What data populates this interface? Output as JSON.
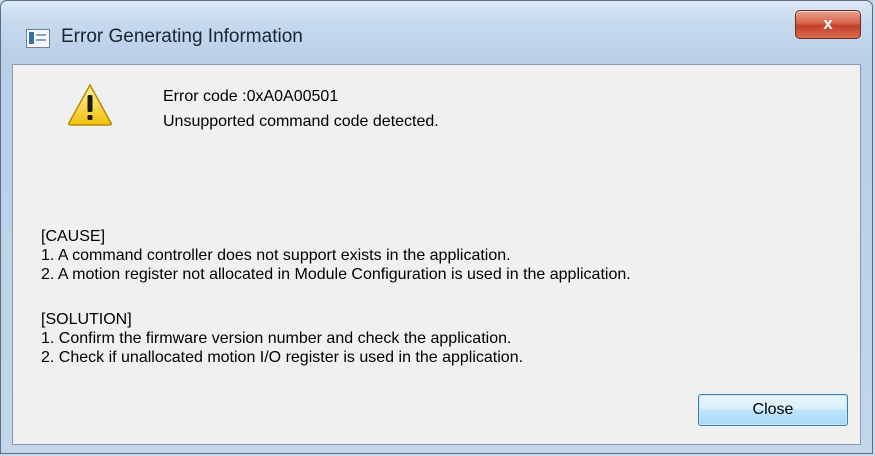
{
  "window": {
    "title": "Error Generating Information",
    "close_glyph": "x"
  },
  "message": {
    "error_code": "Error code :0xA0A00501",
    "description": "Unsupported command code detected."
  },
  "cause": {
    "header": "[CAUSE]",
    "lines": [
      "1. A command controller does not support exists in the application.",
      "2. A motion register not allocated in Module Configuration is used in the application."
    ]
  },
  "solution": {
    "header": "[SOLUTION]",
    "lines": [
      "1. Confirm the firmware version number and check the application.",
      "2. Check if unallocated motion I/O register is used in the application."
    ]
  },
  "buttons": {
    "close_label": "Close"
  },
  "icons": {
    "title": "application-window-icon",
    "warning": "warning-triangle-icon",
    "close": "close-icon"
  },
  "colors": {
    "close_button_red": "#c2412a",
    "warning_yellow": "#f5d020",
    "dialog_bg": "#f0f0f0"
  }
}
